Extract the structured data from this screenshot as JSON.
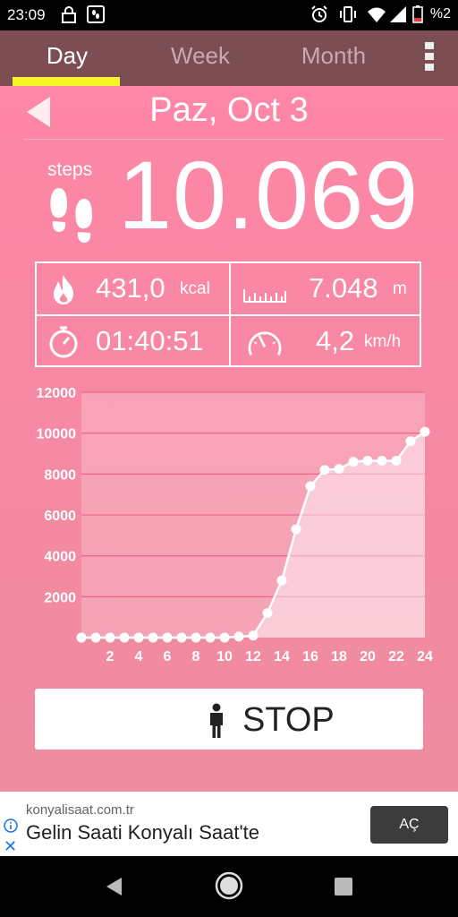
{
  "status_bar": {
    "time": "23:09",
    "battery_percent": "%2"
  },
  "tabs": [
    {
      "label": "Day",
      "active": true
    },
    {
      "label": "Week",
      "active": false
    },
    {
      "label": "Month",
      "active": false
    }
  ],
  "date": {
    "label": "Paz, Oct 3"
  },
  "steps": {
    "label": "steps",
    "value": "10.069"
  },
  "stats": {
    "calories": {
      "value": "431,0",
      "unit": "kcal"
    },
    "distance": {
      "value": "7.048",
      "unit": "m"
    },
    "duration": {
      "value": "01:40:51",
      "unit": ""
    },
    "speed": {
      "value": "4,2",
      "unit": "km/h"
    }
  },
  "chart_data": {
    "type": "area",
    "title": "",
    "xlabel": "",
    "ylabel": "",
    "x": [
      0,
      1,
      2,
      3,
      4,
      5,
      6,
      7,
      8,
      9,
      10,
      11,
      12,
      13,
      14,
      15,
      16,
      17,
      18,
      19,
      20,
      21,
      22,
      23,
      24
    ],
    "values": [
      0,
      0,
      0,
      0,
      0,
      0,
      0,
      0,
      0,
      0,
      0,
      50,
      100,
      1200,
      2800,
      5300,
      7400,
      8200,
      8250,
      8600,
      8650,
      8650,
      8650,
      9600,
      10069
    ],
    "x_ticks": [
      2,
      4,
      6,
      8,
      10,
      12,
      14,
      16,
      18,
      20,
      22,
      24
    ],
    "y_ticks": [
      2000,
      4000,
      6000,
      8000,
      10000,
      12000
    ],
    "xlim": [
      0,
      24
    ],
    "ylim": [
      0,
      12000
    ],
    "grid": true
  },
  "stop_button": {
    "label": "STOP"
  },
  "ad": {
    "domain": "konyalisaat.com.tr",
    "headline": "Gelin Saati Konyalı Saat'te",
    "cta": "AÇ",
    "close": "✕"
  },
  "colors": {
    "background": "#f58aa4",
    "tab_bar": "#7d4d54",
    "tab_indicator": "#f2f52a"
  }
}
